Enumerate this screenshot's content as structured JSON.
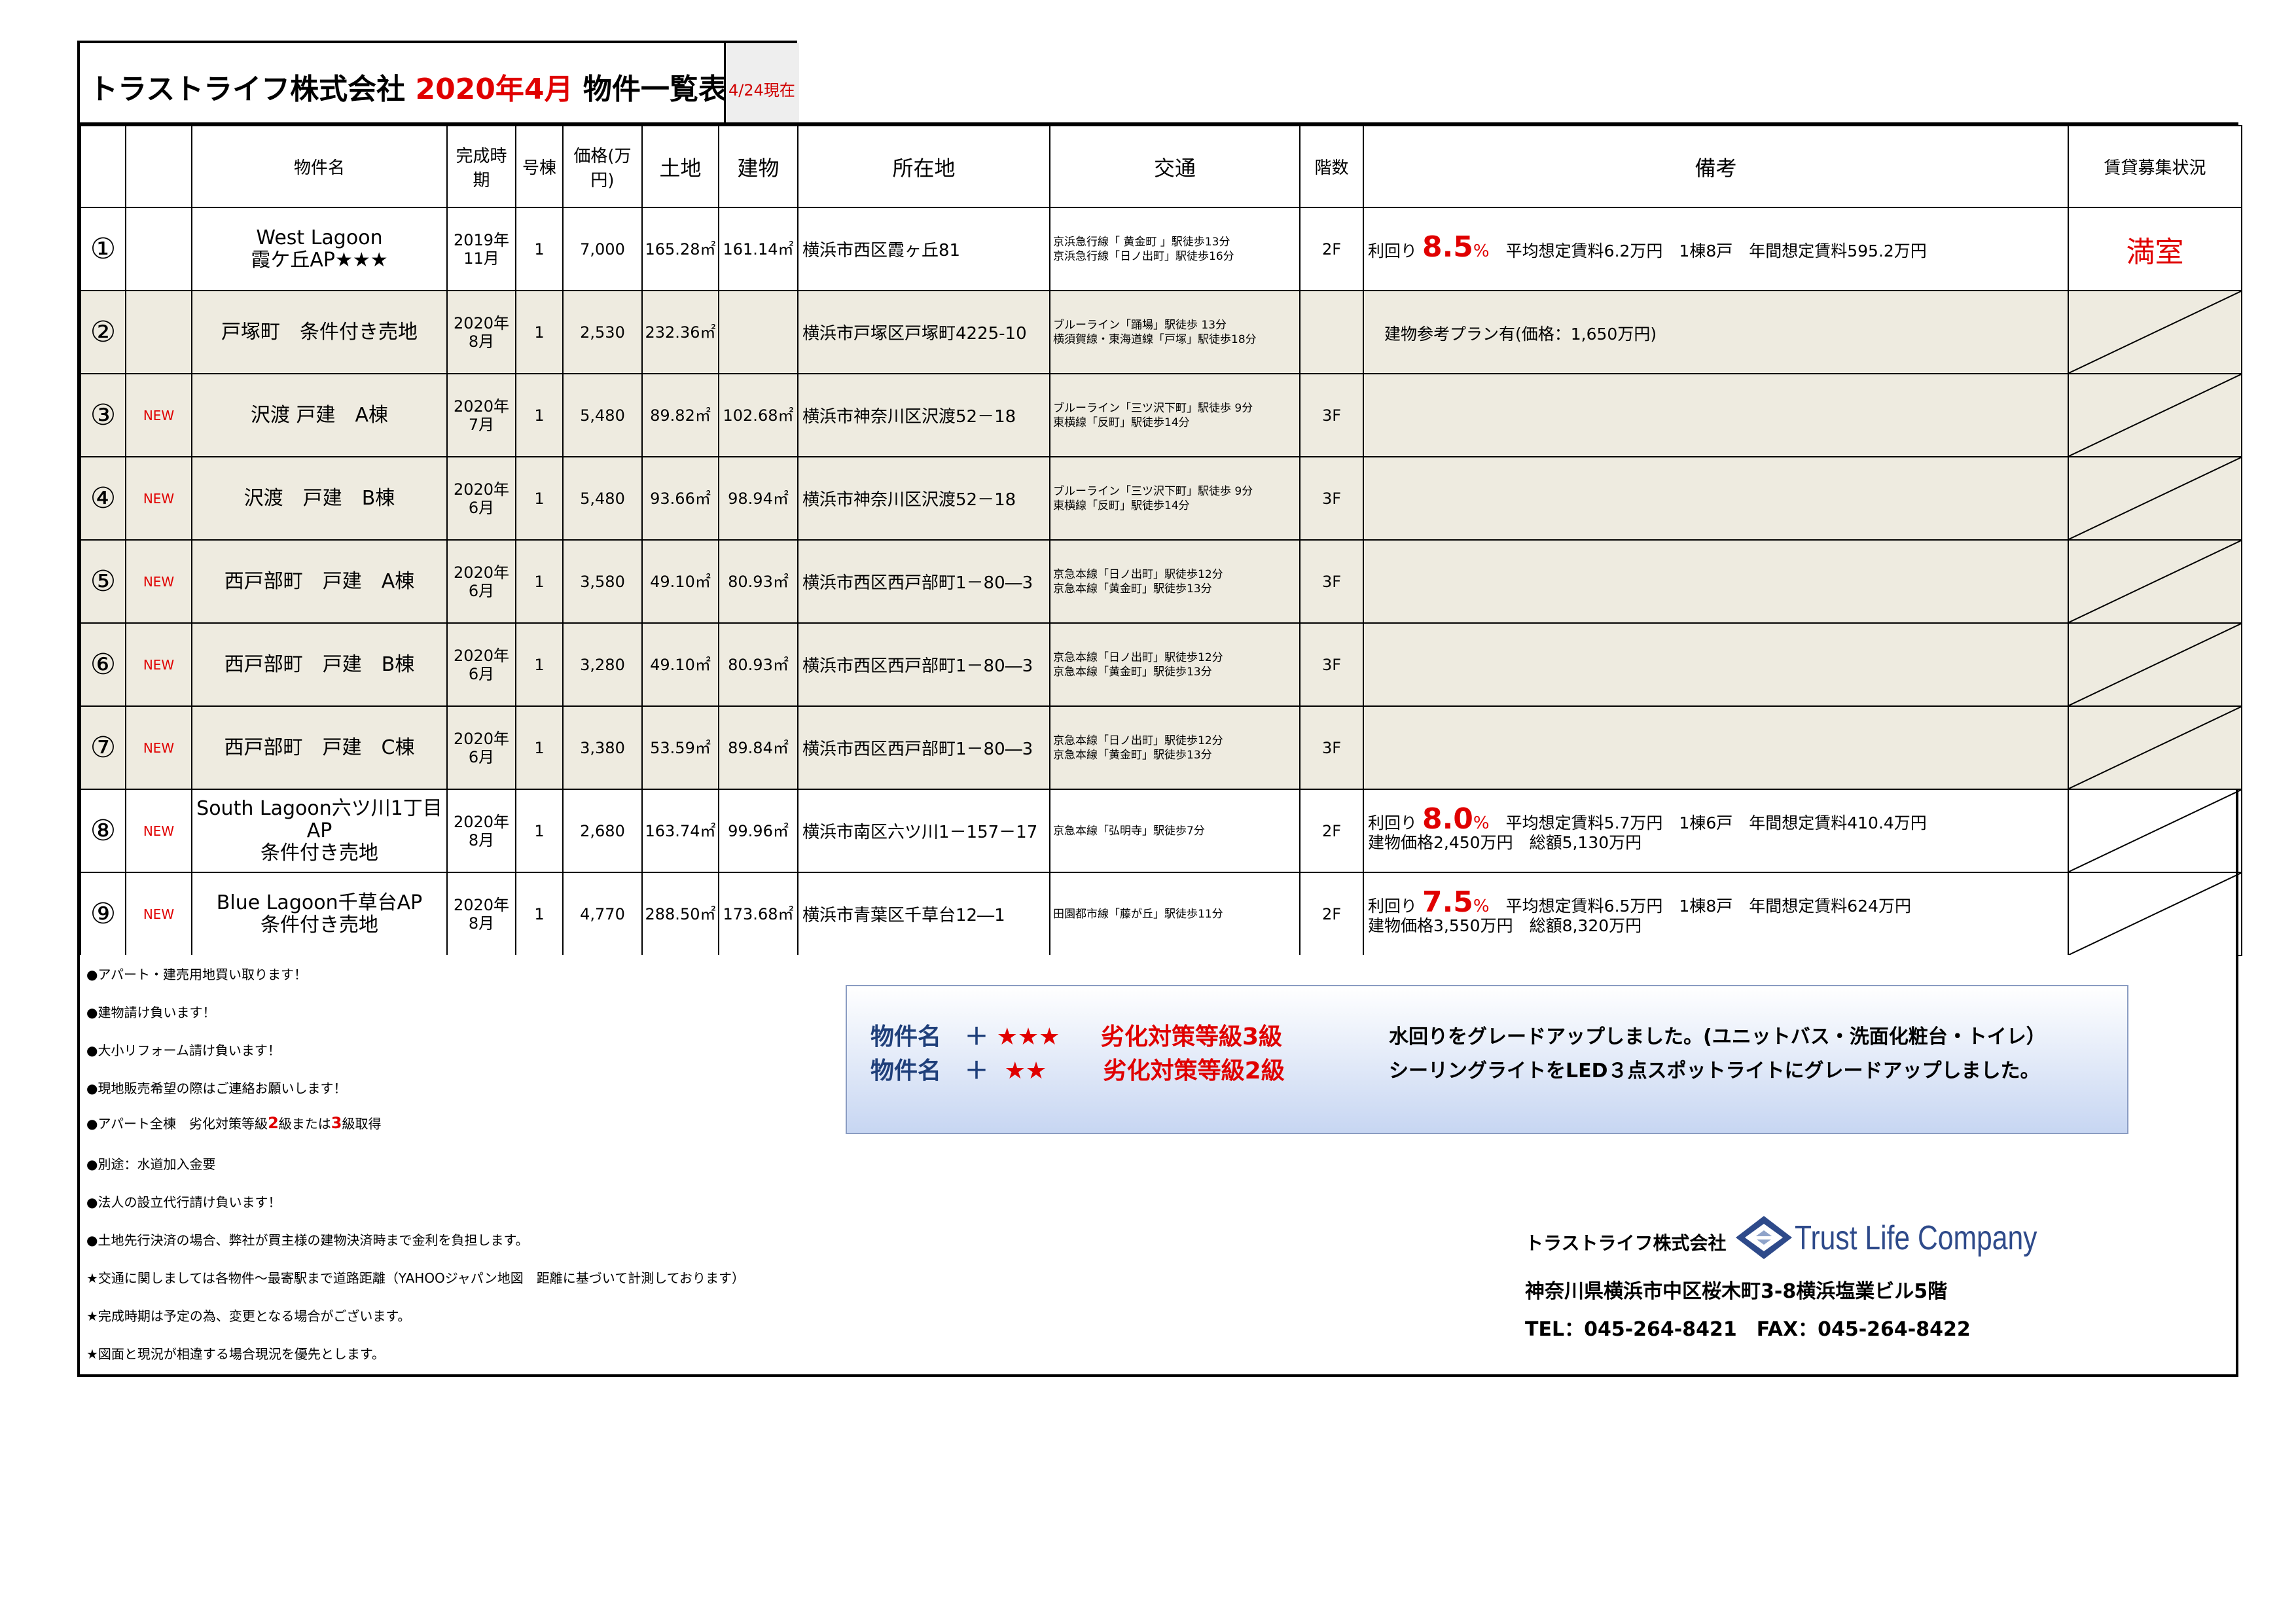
{
  "header": {
    "company": "トラストライフ株式会社",
    "year_month": "2020年4月",
    "list_title": "物件一覧表",
    "as_of": "4/24現在"
  },
  "columns": [
    "",
    "",
    "物件名",
    "完成時期",
    "号棟",
    "価格(万円)",
    "土地",
    "建物",
    "所在地",
    "交通",
    "階数",
    "備考",
    "賃貸募集状況"
  ],
  "rows": [
    {
      "no": "①",
      "new": "",
      "name1": "West Lagoon",
      "name2": "霞ケ丘AP★★★",
      "name3": "",
      "date1": "2019年",
      "date2": "11月",
      "unit": "1",
      "price": "7,000",
      "land": "165.28㎡",
      "bldg": "161.14㎡",
      "addr": "横浜市西区霞ヶ丘81",
      "access1": "京浜急行線「 黄金町 」駅徒歩13分",
      "access2": "京浜急行線「日ノ出町」駅徒歩16分",
      "floors": "2F",
      "yield_label": "利回り",
      "yield": "8.5",
      "yield_pct": "%",
      "remark": "平均想定賃料6.2万円　1棟8戸　年間想定賃料595.2万円",
      "remark2": "",
      "status": "満室"
    },
    {
      "no": "②",
      "new": "",
      "name1": "戸塚町　条件付き売地",
      "name2": "",
      "name3": "",
      "date1": "2020年",
      "date2": "8月",
      "unit": "1",
      "price": "2,530",
      "land": "232.36㎡",
      "bldg": "",
      "addr": "横浜市戸塚区戸塚町4225-10",
      "access1": "ブルーライン「踊場」駅徒歩 13分",
      "access2": "横須賀線・東海道線「戸塚」駅徒歩18分",
      "floors": "",
      "yield_label": "",
      "yield": "",
      "yield_pct": "",
      "remark": "建物参考プラン有(価格：1,650万円)",
      "remark2": "",
      "status": ""
    },
    {
      "no": "③",
      "new": "NEW",
      "name1": "沢渡 戸建　A棟",
      "name2": "",
      "name3": "",
      "date1": "2020年",
      "date2": "7月",
      "unit": "1",
      "price": "5,480",
      "land": "89.82㎡",
      "bldg": "102.68㎡",
      "addr": "横浜市神奈川区沢渡52－18",
      "access1": "ブルーライン「三ツ沢下町」駅徒歩 9分",
      "access2": "東横線「反町」駅徒歩14分",
      "floors": "3F",
      "yield_label": "",
      "yield": "",
      "yield_pct": "",
      "remark": "",
      "remark2": "",
      "status": ""
    },
    {
      "no": "④",
      "new": "NEW",
      "name1": "沢渡　戸建　B棟",
      "name2": "",
      "name3": "",
      "date1": "2020年",
      "date2": "6月",
      "unit": "1",
      "price": "5,480",
      "land": "93.66㎡",
      "bldg": "98.94㎡",
      "addr": "横浜市神奈川区沢渡52－18",
      "access1": "ブルーライン「三ツ沢下町」駅徒歩 9分",
      "access2": "東横線「反町」駅徒歩14分",
      "floors": "3F",
      "yield_label": "",
      "yield": "",
      "yield_pct": "",
      "remark": "",
      "remark2": "",
      "status": ""
    },
    {
      "no": "⑤",
      "new": "NEW",
      "name1": "西戸部町　戸建　A棟",
      "name2": "",
      "name3": "",
      "date1": "2020年",
      "date2": "6月",
      "unit": "1",
      "price": "3,580",
      "land": "49.10㎡",
      "bldg": "80.93㎡",
      "addr": "横浜市西区西戸部町1－80―3",
      "access1": "京急本線「日ノ出町」駅徒歩12分",
      "access2": "京急本線「黄金町」駅徒歩13分",
      "floors": "3F",
      "yield_label": "",
      "yield": "",
      "yield_pct": "",
      "remark": "",
      "remark2": "",
      "status": ""
    },
    {
      "no": "⑥",
      "new": "NEW",
      "name1": "西戸部町　戸建　B棟",
      "name2": "",
      "name3": "",
      "date1": "2020年",
      "date2": "6月",
      "unit": "1",
      "price": "3,280",
      "land": "49.10㎡",
      "bldg": "80.93㎡",
      "addr": "横浜市西区西戸部町1－80―3",
      "access1": "京急本線「日ノ出町」駅徒歩12分",
      "access2": "京急本線「黄金町」駅徒歩13分",
      "floors": "3F",
      "yield_label": "",
      "yield": "",
      "yield_pct": "",
      "remark": "",
      "remark2": "",
      "status": ""
    },
    {
      "no": "⑦",
      "new": "NEW",
      "name1": "西戸部町　戸建　C棟",
      "name2": "",
      "name3": "",
      "date1": "2020年",
      "date2": "6月",
      "unit": "1",
      "price": "3,380",
      "land": "53.59㎡",
      "bldg": "89.84㎡",
      "addr": "横浜市西区西戸部町1－80―3",
      "access1": "京急本線「日ノ出町」駅徒歩12分",
      "access2": "京急本線「黄金町」駅徒歩13分",
      "floors": "3F",
      "yield_label": "",
      "yield": "",
      "yield_pct": "",
      "remark": "",
      "remark2": "",
      "status": ""
    },
    {
      "no": "⑧",
      "new": "NEW",
      "name1": "South Lagoon六ツ川1丁目",
      "name2": "AP",
      "name3": "条件付き売地",
      "date1": "2020年",
      "date2": "8月",
      "unit": "1",
      "price": "2,680",
      "land": "163.74㎡",
      "bldg": "99.96㎡",
      "addr": "横浜市南区六ツ川1－157－17",
      "access1": "京急本線「弘明寺」駅徒歩7分",
      "access2": "",
      "floors": "2F",
      "yield_label": "利回り",
      "yield": "8.0",
      "yield_pct": "%",
      "remark": "平均想定賃料5.7万円　1棟6戸　年間想定賃料410.4万円",
      "remark2": "建物価格2,450万円　総額5,130万円",
      "status": ""
    },
    {
      "no": "⑨",
      "new": "NEW",
      "name1": "Blue Lagoon千草台AP",
      "name2": "条件付き売地",
      "name3": "",
      "date1": "2020年",
      "date2": "8月",
      "unit": "1",
      "price": "4,770",
      "land": "288.50㎡",
      "bldg": "173.68㎡",
      "addr": "横浜市青葉区千草台12―1",
      "access1": "田園都市線「藤が丘」駅徒歩11分",
      "access2": "",
      "floors": "2F",
      "yield_label": "利回り",
      "yield": "7.5",
      "yield_pct": "%",
      "remark": "平均想定賃料6.5万円　1棟8戸　年間想定賃料624万円",
      "remark2": "建物価格3,550万円　総額8,320万円",
      "status": ""
    }
  ],
  "footer_notes": [
    {
      "text": "●アパート・建売用地買い取ります！"
    },
    {
      "text": "●建物請け負います！"
    },
    {
      "text": "●大小リフォーム請け負います！"
    },
    {
      "text": "●現地販売希望の際はご連絡お願いします！"
    },
    {
      "text_a": "●アパート全棟　劣化対策等級",
      "r1": "2",
      "text_b": "級または",
      "r2": "3",
      "text_c": "級取得"
    },
    {
      "text": "●別途：水道加入金要"
    },
    {
      "text": "●法人の設立代行請け負います！"
    },
    {
      "text": "●土地先行決済の場合、弊社が買主様の建物決済時まで金利を負担します。"
    },
    {
      "text": "★交通に関しましては各物件～最寄駅まで道路距離（YAHOOジャパン地図　距離に基づいて計測しております）"
    },
    {
      "text": "★完成時期は予定の為、変更となる場合がございます。"
    },
    {
      "text": "★図面と現況が相違する場合現況を優先とします。"
    }
  ],
  "legend": [
    {
      "label": "物件名　＋",
      "stars": "★★★",
      "grade": "劣化対策等級3級",
      "desc": "水回りをグレードアップしました。(ユニットバス・洗面化粧台・トイレ）"
    },
    {
      "label": "物件名　＋",
      "stars": "★★",
      "grade": "劣化対策等級2級",
      "desc": "シーリングライトをLED３点スポットライトにグレードアップしました。"
    }
  ],
  "company": {
    "name": "トラストライフ株式会社",
    "logo": "Trust Life Company",
    "address": "神奈川県横浜市中区桜木町3-8横浜塩業ビル5階",
    "tel": "TEL：045-264-8421　FAX：045-264-8422"
  },
  "colors": {
    "accent_red": "#e00000",
    "row_shade": "#eeebe0",
    "legend_text": "#1f3f7a",
    "logo_blue": "#2e4a8a"
  }
}
